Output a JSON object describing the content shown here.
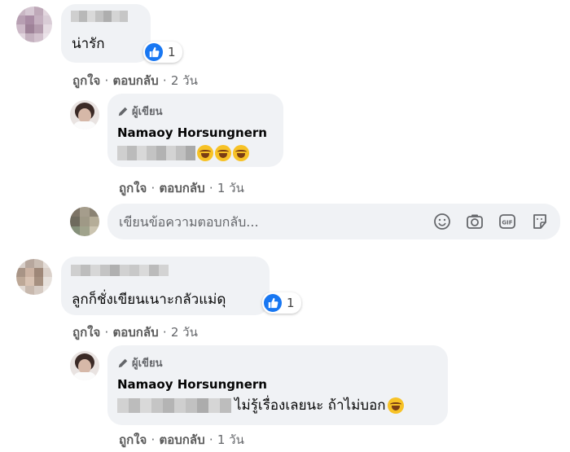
{
  "comments": [
    {
      "text": "น่ารัก",
      "like_count": "1",
      "actions": {
        "like": "ถูกใจ",
        "sep": "·",
        "reply": "ตอบกลับ",
        "time": "2 วัน"
      },
      "reply": {
        "author_badge": "ผู้เขียน",
        "name": "Namaoy Horsungnern",
        "text": "",
        "actions": {
          "like": "ถูกใจ",
          "sep": "·",
          "reply": "ตอบกลับ",
          "time": "1 วัน"
        }
      }
    },
    {
      "text": "ลูกก็ชั่งเขียนเนาะกลัวแม่ดุ",
      "like_count": "1",
      "actions": {
        "like": "ถูกใจ",
        "sep": "·",
        "reply": "ตอบกลับ",
        "time": "2 วัน"
      },
      "reply": {
        "author_badge": "ผู้เขียน",
        "name": "Namaoy Horsungnern",
        "text": "ไม่รู้เรื่องเลยนะ ถ้าไม่บอก",
        "actions": {
          "like": "ถูกใจ",
          "sep": "·",
          "reply": "ตอบกลับ",
          "time": "1 วัน"
        }
      }
    }
  ],
  "reply_box": {
    "placeholder": "เขียนข้อความตอบกลับ...",
    "icons": [
      "emoji-icon",
      "camera-icon",
      "gif-icon",
      "sticker-icon"
    ]
  },
  "colors": {
    "like_blue": "#1877f2",
    "bubble": "#f0f2f5",
    "meta": "#65676b"
  }
}
